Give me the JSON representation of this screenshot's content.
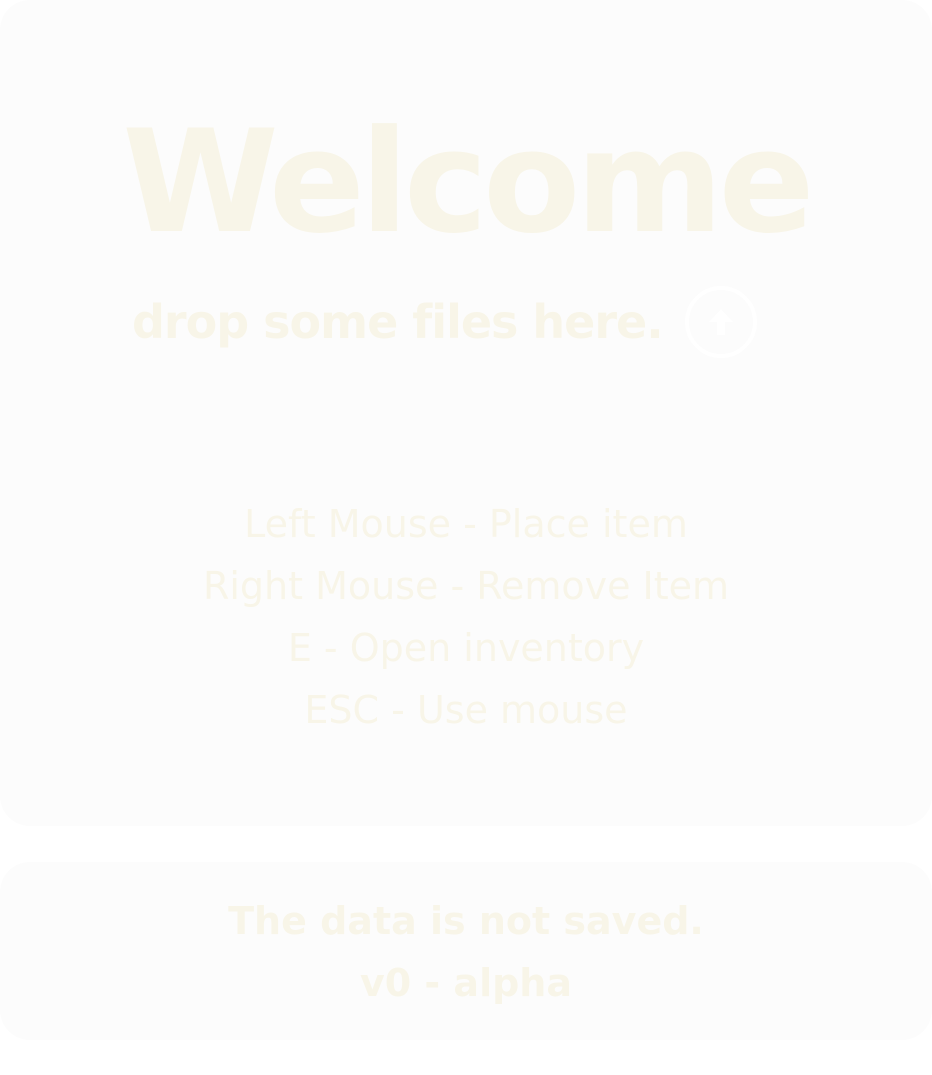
{
  "main": {
    "title": "Welcome",
    "drop_text": "drop some files here.",
    "upload_icon": "upload-arrow-icon",
    "controls": [
      "Left Mouse - Place item",
      "Right Mouse - Remove Item",
      "E - Open inventory",
      "ESC - Use mouse"
    ]
  },
  "footer": {
    "notice": "The data is not saved.",
    "version": "v0 - alpha"
  },
  "colors": {
    "panel": "#fcfcfc",
    "text": "#f8f5e8",
    "icon": "#ffffff"
  }
}
